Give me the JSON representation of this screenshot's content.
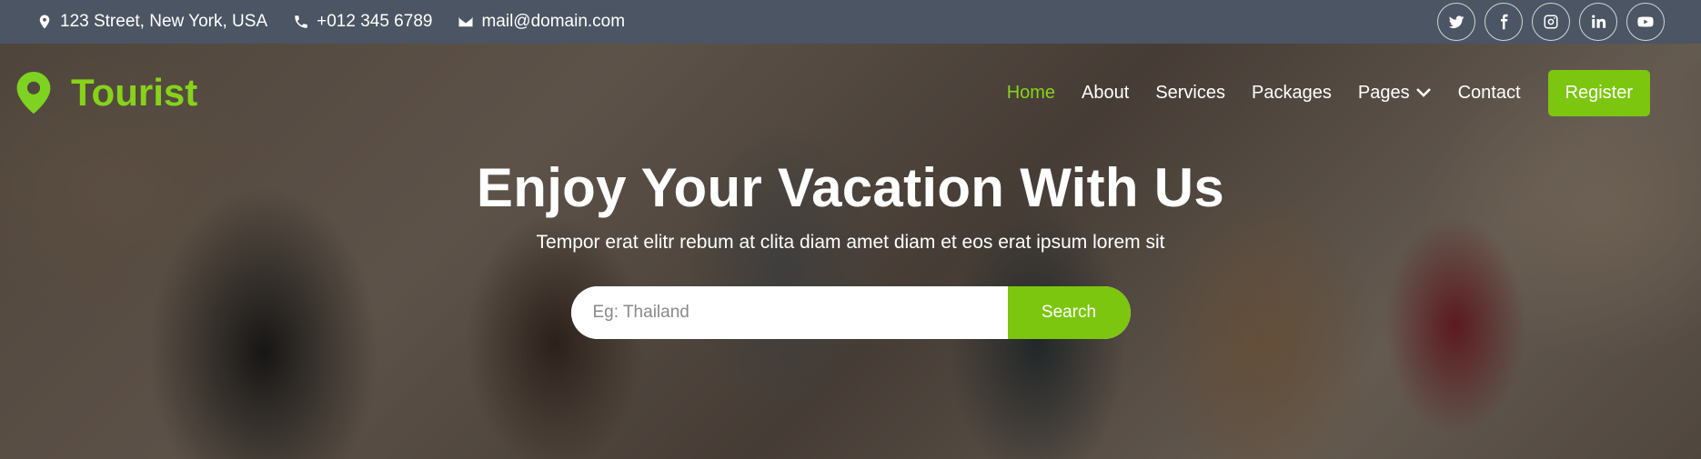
{
  "topbar": {
    "address": "123 Street, New York, USA",
    "phone": "+012 345 6789",
    "email": "mail@domain.com",
    "socials": [
      "twitter-icon",
      "facebook-icon",
      "instagram-icon",
      "linkedin-icon",
      "youtube-icon"
    ]
  },
  "brand": {
    "name": "Tourist",
    "icon": "map-marker-icon",
    "color": "#86d31a"
  },
  "nav": {
    "items": [
      {
        "label": "Home",
        "active": true
      },
      {
        "label": "About"
      },
      {
        "label": "Services"
      },
      {
        "label": "Packages"
      },
      {
        "label": "Pages",
        "dropdown": true
      },
      {
        "label": "Contact"
      }
    ],
    "register_label": "Register"
  },
  "hero": {
    "title": "Enjoy Your Vacation With Us",
    "subtitle": "Tempor erat elitr rebum at clita diam amet diam et eos erat ipsum lorem sit",
    "search": {
      "placeholder": "Eg: Thailand",
      "value": "",
      "button_label": "Search"
    }
  },
  "colors": {
    "accent": "#7cc60f",
    "topbar_bg": "#4b5563"
  }
}
